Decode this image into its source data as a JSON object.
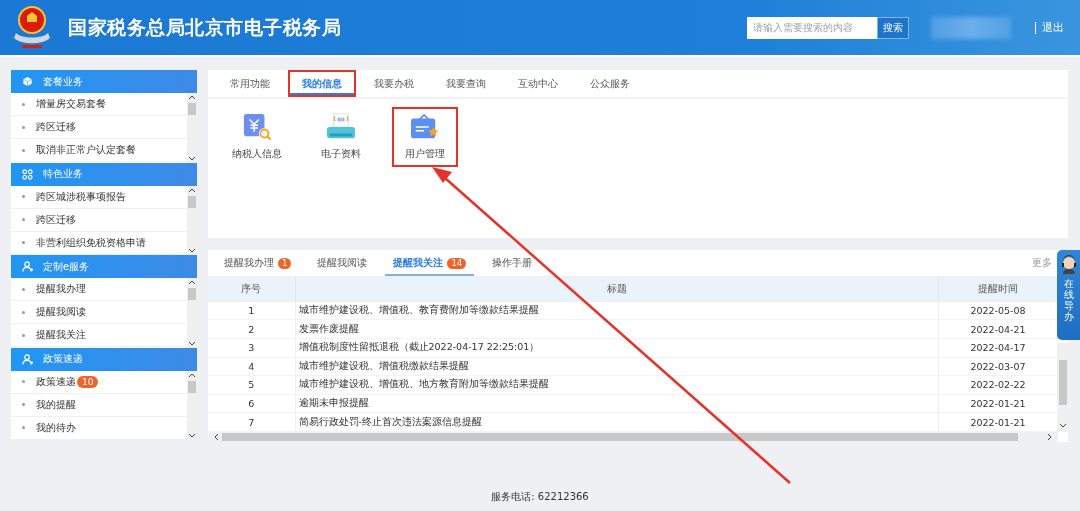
{
  "header": {
    "title": "国家税务总局北京市电子税务局",
    "search": {
      "placeholder": "请输入需要搜索的内容",
      "button": "搜索"
    },
    "logout": "退出"
  },
  "sidebar": [
    {
      "title": "套餐业务",
      "kind": "cube",
      "items": [
        {
          "label": "增量房交易套餐"
        },
        {
          "label": "跨区迁移"
        },
        {
          "label": "取消非正常户认定套餐"
        }
      ]
    },
    {
      "title": "特色业务",
      "kind": "grid",
      "items": [
        {
          "label": "跨区城涉税事项报告"
        },
        {
          "label": "跨区迁移"
        },
        {
          "label": "非营利组织免税资格申请"
        }
      ]
    },
    {
      "title": "定制e服务",
      "kind": "user",
      "items": [
        {
          "label": "提醒我办理"
        },
        {
          "label": "提醒我阅读"
        },
        {
          "label": "提醒我关注"
        }
      ]
    },
    {
      "title": "政策速递",
      "kind": "user",
      "items": [
        {
          "label": "政策速递",
          "badge": "10"
        },
        {
          "label": "我的提醒"
        },
        {
          "label": "我的待办"
        }
      ]
    }
  ],
  "top_card": {
    "tabs": [
      {
        "label": "常用功能",
        "selected": false,
        "annotated": false
      },
      {
        "label": "我的信息",
        "selected": true,
        "annotated": true
      },
      {
        "label": "我要办税",
        "selected": false,
        "annotated": false
      },
      {
        "label": "我要查询",
        "selected": false,
        "annotated": false
      },
      {
        "label": "互动中心",
        "selected": false,
        "annotated": false
      },
      {
        "label": "公众服务",
        "selected": false,
        "annotated": false
      }
    ],
    "apps": [
      {
        "label": "纳税人信息",
        "kind": "receipt",
        "annotated": false
      },
      {
        "label": "电子资料",
        "kind": "printer",
        "annotated": false
      },
      {
        "label": "用户管理",
        "kind": "card",
        "annotated": true
      }
    ]
  },
  "bottom_card": {
    "tabs": [
      {
        "label": "提醒我办理",
        "badge": "1",
        "selected": false
      },
      {
        "label": "提醒我阅读",
        "selected": false
      },
      {
        "label": "提醒我关注",
        "badge": "14",
        "selected": true
      },
      {
        "label": "操作手册",
        "selected": false
      }
    ],
    "more": "更多",
    "table": {
      "columns": [
        "序号",
        "标题",
        "提醒时间"
      ],
      "rows": [
        [
          "1",
          "城市维护建设税、增值税、教育费附加等缴款结果提醒",
          "2022-05-08"
        ],
        [
          "2",
          "发票作废提醒",
          "2022-04-21"
        ],
        [
          "3",
          "增值税制度性留抵退税（截止2022-04-17 22:25:01）",
          "2022-04-17"
        ],
        [
          "4",
          "城市维护建设税、增值税缴款结果提醒",
          "2022-03-07"
        ],
        [
          "5",
          "城市维护建设税、增值税、地方教育附加等缴款结果提醒",
          "2022-02-22"
        ],
        [
          "6",
          "逾期未申报提醒",
          "2022-01-21"
        ],
        [
          "7",
          "简易行政处罚-终止首次违法案源信息提醒",
          "2022-01-21"
        ]
      ]
    }
  },
  "guide_widget": "在线导办",
  "footer": "服务电话: 62212366"
}
